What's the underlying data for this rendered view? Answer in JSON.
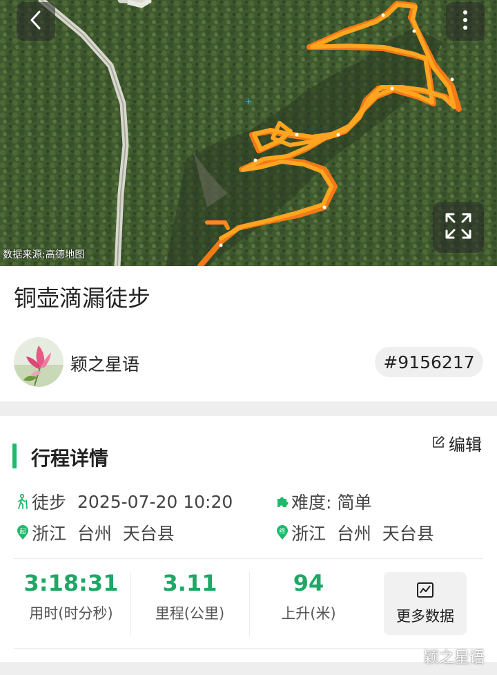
{
  "map": {
    "source_label": "数据来源:高德地图",
    "colors": {
      "track": "#ffa01c",
      "track_dark": "#f47a16",
      "forest": "#3f5a32",
      "trail": "#dcdcd2"
    },
    "icons": [
      "back-icon",
      "more-icon",
      "fullscreen-icon"
    ]
  },
  "trip": {
    "title": "铜壶滴漏徒步",
    "author": "颖之星语",
    "id_badge": "#9156217"
  },
  "detail": {
    "section_title": "行程详情",
    "edit_label": "编辑",
    "activity_type": "徒步",
    "datetime": "2025-07-20 10:20",
    "difficulty_label": "难度:",
    "difficulty_value": "简单",
    "start_location": "浙江  台州  天台县",
    "end_location": "浙江  台州  天台县",
    "start_marker": "起",
    "end_marker": "终",
    "accent_color": "#1fb96a",
    "value_color": "#1fa765"
  },
  "stats": [
    {
      "value": "3:18:31",
      "label": "用时(时分秒)"
    },
    {
      "value": "3.11",
      "label": "里程(公里)"
    },
    {
      "value": "94",
      "label": "上升(米)"
    }
  ],
  "more_data_label": "更多数据",
  "watermark": "颖之星语"
}
